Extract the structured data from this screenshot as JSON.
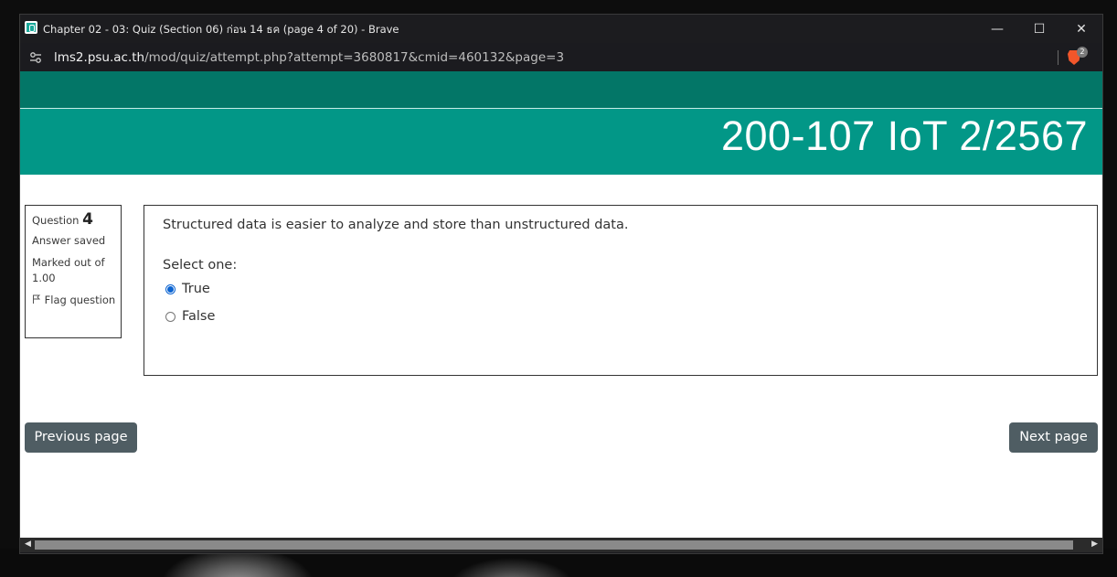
{
  "window": {
    "title": "Chapter 02 - 03: Quiz (Section 06) ก่อน 14 ธค (page 4 of 20) - Brave",
    "controls": {
      "minimize": "—",
      "maximize": "☐",
      "close": "✕"
    },
    "app_icon": "browser-app-icon"
  },
  "address_bar": {
    "host": "lms2.psu.ac.th",
    "path": "/mod/quiz/attempt.php?attempt=3680817&cmid=460132&page=3",
    "brave_badge": "2"
  },
  "course": {
    "title": "200-107 IoT 2/2567"
  },
  "question_info": {
    "label": "Question",
    "number": "4",
    "status": "Answer saved",
    "marked_out_of": "Marked out of",
    "max_mark": "1.00",
    "flag_label": "Flag question"
  },
  "question": {
    "text": "Structured data is easier to analyze and store than unstructured data.",
    "prompt": "Select one:",
    "options": [
      {
        "label": "True",
        "selected": true
      },
      {
        "label": "False",
        "selected": false
      }
    ]
  },
  "navigation": {
    "previous": "Previous page",
    "next": "Next page"
  },
  "colors": {
    "header_dark": "#037667",
    "header_main": "#029787",
    "button": "#4f5d63",
    "radio_accent": "#0b63d1"
  }
}
